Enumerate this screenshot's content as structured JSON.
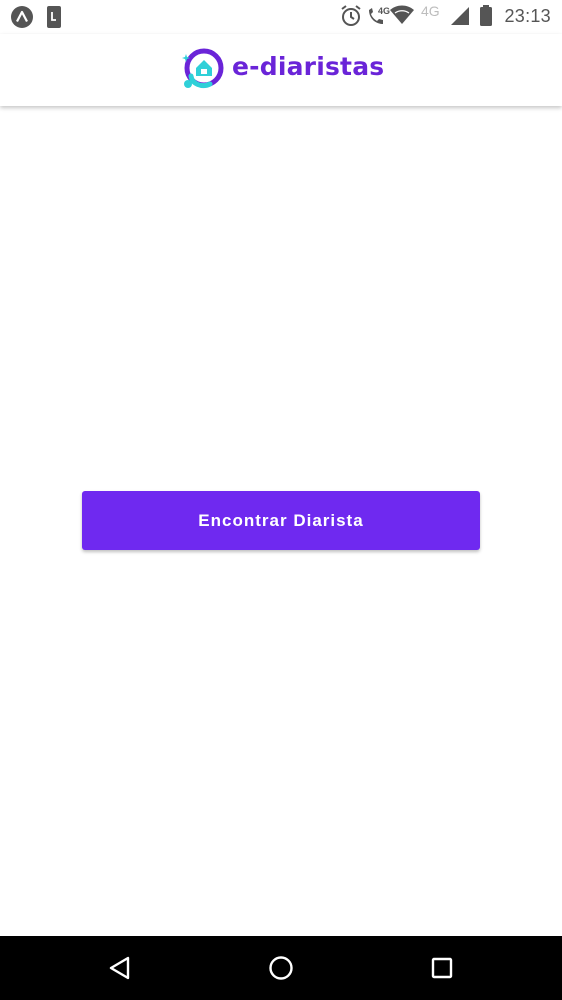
{
  "status_bar": {
    "time": "23:13",
    "network_type": "4G",
    "left_icons": [
      "app-a-icon",
      "phone-notification-icon"
    ],
    "right_icons": [
      "alarm-icon",
      "volte-call-icon",
      "wifi-icon",
      "cell-signal-icon",
      "battery-icon"
    ]
  },
  "header": {
    "logo_text": "e-diaristas",
    "brand_color": "#6a24d8",
    "accent_color": "#2fd0d8"
  },
  "main": {
    "find_button_label": "Encontrar Diarista",
    "button_color": "#6f29f0"
  },
  "nav_bar": {
    "items": [
      "back-icon",
      "home-icon",
      "recents-icon"
    ]
  }
}
